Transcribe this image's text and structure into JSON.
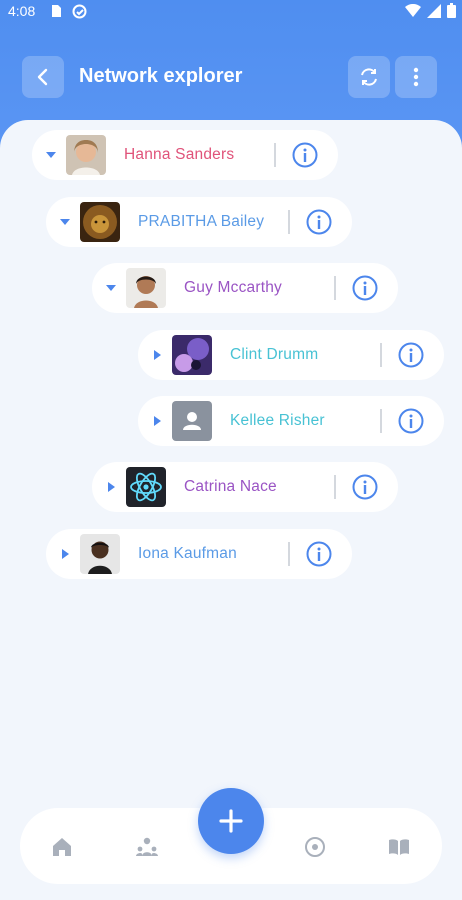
{
  "status_bar": {
    "time": "4:08"
  },
  "header": {
    "title": "Network explorer"
  },
  "tree": [
    {
      "name": "Hanna Sanders",
      "color": "#e0537a",
      "expanded": true,
      "avatar": "photo-woman"
    },
    {
      "name": "PRABITHA Bailey",
      "color": "#5b9be6",
      "expanded": true,
      "avatar": "lion-image"
    },
    {
      "name": "Guy Mccarthy",
      "color": "#9a54c4",
      "expanded": true,
      "avatar": "photo-woman-2"
    },
    {
      "name": "Clint Drumm",
      "color": "#48c2d4",
      "expanded": false,
      "avatar": "purple-image"
    },
    {
      "name": "Kellee Risher",
      "color": "#48c2d4",
      "expanded": false,
      "avatar": "placeholder-person"
    },
    {
      "name": "Catrina Nace",
      "color": "#9a54c4",
      "expanded": false,
      "avatar": "react-logo"
    },
    {
      "name": "Iona Kaufman",
      "color": "#5b9be6",
      "expanded": false,
      "avatar": "photo-man"
    }
  ],
  "colors": {
    "accent": "#4c86ec",
    "header": "#5b96f4"
  }
}
